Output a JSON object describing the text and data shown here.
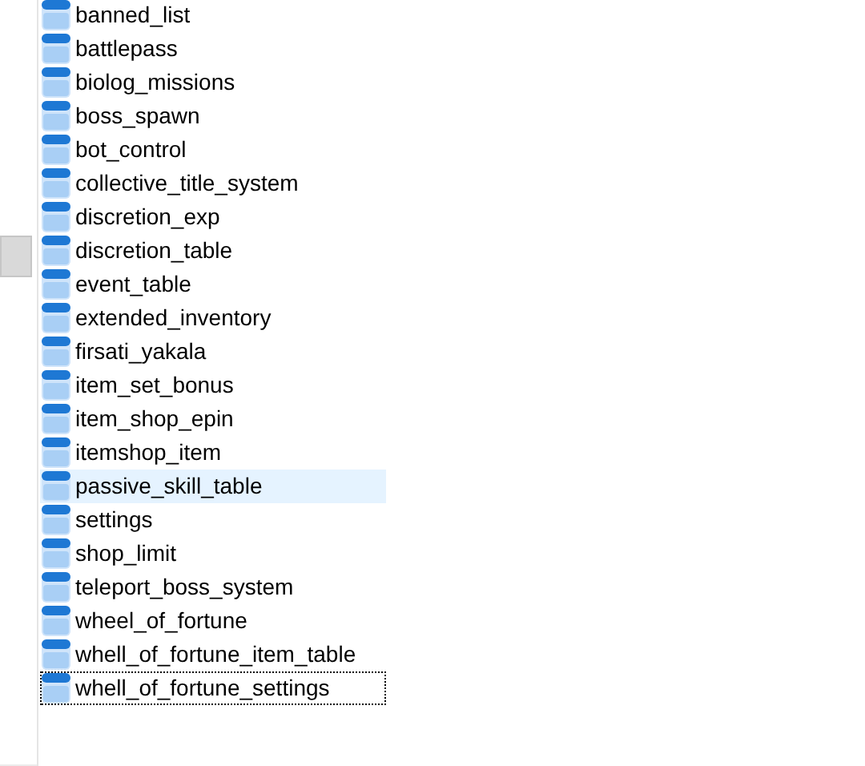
{
  "tables": [
    {
      "name": "banned_list",
      "hovered": false,
      "focused": false
    },
    {
      "name": "battlepass",
      "hovered": false,
      "focused": false
    },
    {
      "name": "biolog_missions",
      "hovered": false,
      "focused": false
    },
    {
      "name": "boss_spawn",
      "hovered": false,
      "focused": false
    },
    {
      "name": "bot_control",
      "hovered": false,
      "focused": false
    },
    {
      "name": "collective_title_system",
      "hovered": false,
      "focused": false
    },
    {
      "name": "discretion_exp",
      "hovered": false,
      "focused": false
    },
    {
      "name": "discretion_table",
      "hovered": false,
      "focused": false
    },
    {
      "name": "event_table",
      "hovered": false,
      "focused": false
    },
    {
      "name": "extended_inventory",
      "hovered": false,
      "focused": false
    },
    {
      "name": "firsati_yakala",
      "hovered": false,
      "focused": false
    },
    {
      "name": "item_set_bonus",
      "hovered": false,
      "focused": false
    },
    {
      "name": "item_shop_epin",
      "hovered": false,
      "focused": false
    },
    {
      "name": "itemshop_item",
      "hovered": false,
      "focused": false
    },
    {
      "name": "passive_skill_table",
      "hovered": true,
      "focused": false
    },
    {
      "name": "settings",
      "hovered": false,
      "focused": false
    },
    {
      "name": "shop_limit",
      "hovered": false,
      "focused": false
    },
    {
      "name": "teleport_boss_system",
      "hovered": false,
      "focused": false
    },
    {
      "name": "wheel_of_fortune",
      "hovered": false,
      "focused": false
    },
    {
      "name": "whell_of_fortune_item_table",
      "hovered": false,
      "focused": false
    },
    {
      "name": "whell_of_fortune_settings",
      "hovered": false,
      "focused": true
    }
  ]
}
